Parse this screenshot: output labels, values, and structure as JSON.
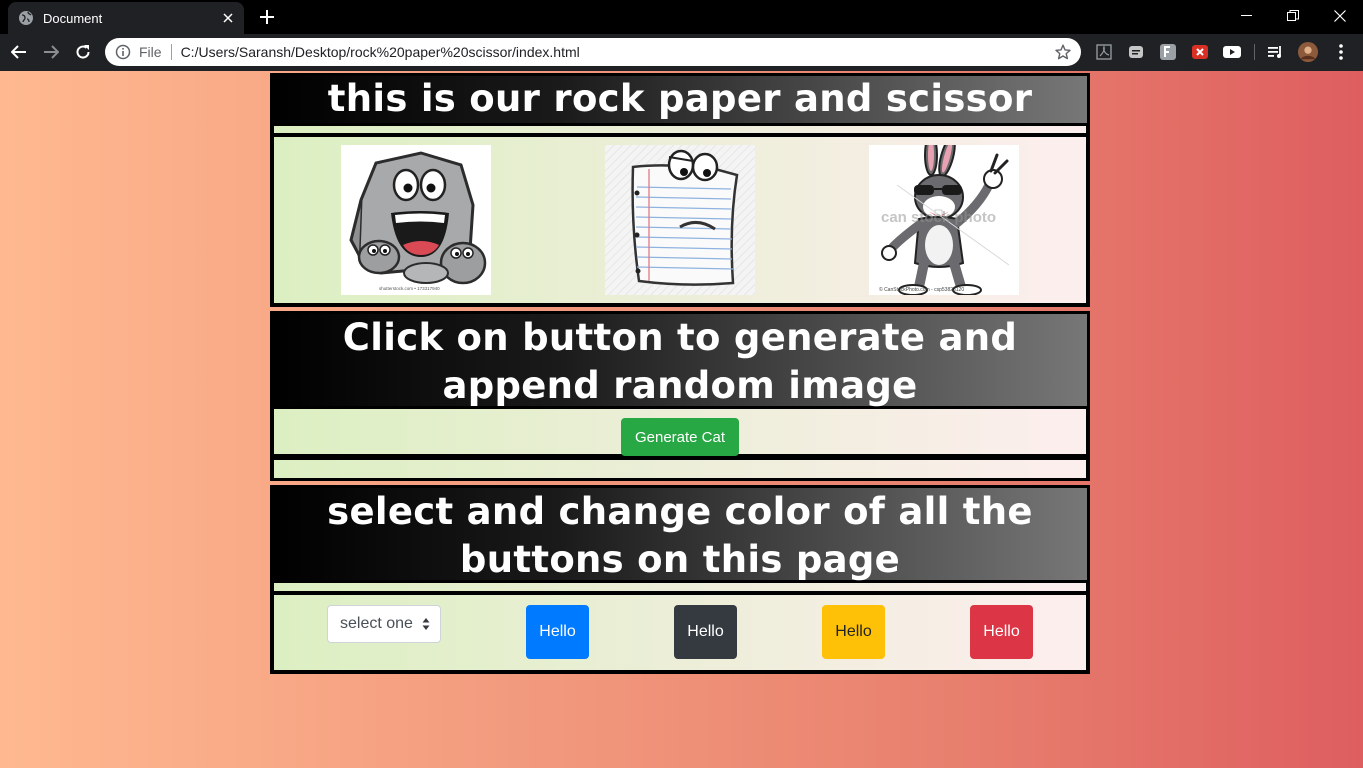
{
  "browser": {
    "tab_title": "Document",
    "address_scheme": "File",
    "address_url": "C:/Users/Saransh/Desktop/rock%20paper%20scissor/index.html"
  },
  "page": {
    "heading": "this is our rock paper and scissor",
    "images": [
      {
        "name": "rock",
        "caption": "shutterstock.com • 173317940"
      },
      {
        "name": "paper",
        "caption": ""
      },
      {
        "name": "scissor",
        "caption": "© CanStockPhoto.com - csp53823120",
        "watermark": "can stock photo"
      }
    ],
    "generate_heading": "Click on button to generate and append random image",
    "generate_button": "Generate Cat",
    "color_heading": "select and change color of all the buttons on this page",
    "select_value": "select one",
    "hello_buttons": [
      {
        "label": "Hello",
        "color": "#007bff",
        "text_color": "#ffffff"
      },
      {
        "label": "Hello",
        "color": "#343a40",
        "text_color": "#ffffff"
      },
      {
        "label": "Hello",
        "color": "#ffc107",
        "text_color": "#212529"
      },
      {
        "label": "Hello",
        "color": "#dc3545",
        "text_color": "#ffffff"
      }
    ],
    "generate_button_color": "#28a745"
  }
}
